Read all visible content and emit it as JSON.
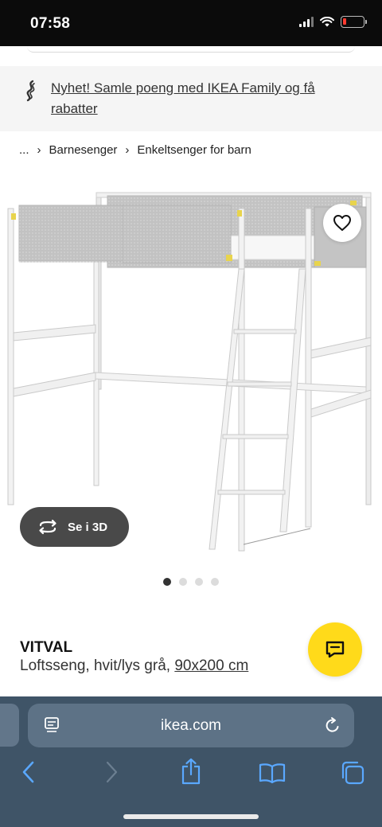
{
  "status_bar": {
    "time": "07:58"
  },
  "promo": {
    "text": "Nyhet! Samle poeng med IKEA Family og få rabatter"
  },
  "breadcrumb": {
    "ellipsis": "...",
    "items": [
      "Barnesenger",
      "Enkeltsenger for barn"
    ]
  },
  "gallery": {
    "button_3d": "Se i 3D",
    "slide_count": 4,
    "active_slide": 1
  },
  "product": {
    "name": "VITVAL",
    "description": "Loftsseng, hvit/lys grå,",
    "size": "90x200 cm"
  },
  "browser": {
    "url": "ikea.com"
  },
  "colors": {
    "accent_yellow": "#ffda1a",
    "browser_bg": "#3f5467",
    "link_blue": "#5aa8ff"
  }
}
